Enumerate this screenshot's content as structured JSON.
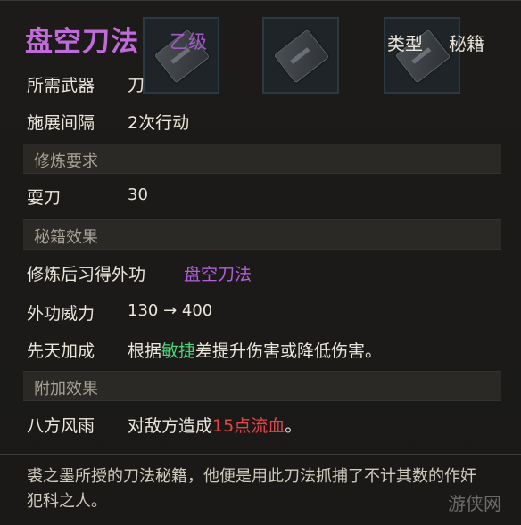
{
  "header": {
    "title": "盘空刀法",
    "grade": "乙级",
    "type_label": "类型",
    "type_value": "秘籍"
  },
  "stats": [
    {
      "label": "所需武器",
      "value": "刀"
    },
    {
      "label": "施展间隔",
      "value": "2次行动"
    }
  ],
  "sections": {
    "train_req": "修炼要求",
    "effects": "秘籍效果",
    "extra": "附加效果"
  },
  "train_req": {
    "label": "耍刀",
    "value": "30"
  },
  "effects": {
    "learn_label": "修炼后习得外功",
    "learn_value": "盘空刀法",
    "power_label": "外功威力",
    "power_value": "130 → 400",
    "innate_label": "先天加成",
    "innate_pre": "根据",
    "innate_highlight": "敏捷",
    "innate_post": "差提升伤害或降低伤害。"
  },
  "extra": {
    "label": "八方风雨",
    "pre": "对敌方造成",
    "highlight": "15点流血",
    "post": "。"
  },
  "description": "裘之墨所授的刀法秘籍，他便是用此刀法抓捕了不计其数的作奸犯科之人。",
  "watermark": "游侠网",
  "colors": {
    "title": "#c06cd8",
    "skill_name": "#b060d8",
    "highlight_green": "#4fd27a",
    "highlight_red": "#e2454a"
  },
  "icons": [
    "book-icon",
    "book-icon",
    "book-icon"
  ]
}
